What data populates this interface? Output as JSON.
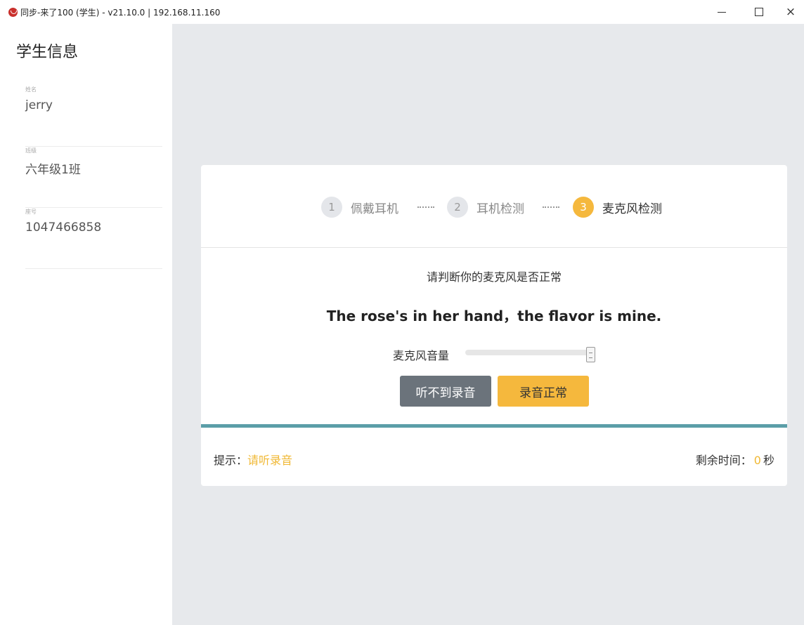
{
  "window": {
    "title": "同步-来了100 (学生) - v21.10.0 | 192.168.11.160",
    "close_glyph": "×"
  },
  "sidebar": {
    "title": "学生信息",
    "items": [
      {
        "label": "姓名",
        "value": "jerry"
      },
      {
        "label": "班级",
        "value": "六年级1班"
      },
      {
        "label": "座号",
        "value": "1047466858"
      }
    ]
  },
  "steps": [
    {
      "number": "1",
      "label": "佩戴耳机",
      "active": false
    },
    {
      "number": "2",
      "label": "耳机检测",
      "active": false
    },
    {
      "number": "3",
      "label": "麦克风检测",
      "active": true
    }
  ],
  "check": {
    "question": "请判断你的麦克风是否正常",
    "sentence": "The rose's in her hand，the flavor is mine.",
    "volume_label": "麦克风音量",
    "volume_level": 1.0
  },
  "buttons": {
    "cannot_hear": "听不到录音",
    "recording_ok": "录音正常"
  },
  "footer": {
    "hint_label": "提示：",
    "hint_value": "请听录音",
    "time_label": "剩余时间：",
    "time_value": "0",
    "time_unit": "秒"
  },
  "colors": {
    "accent": "#f5b83d",
    "progress_bar": "#5b9ea8",
    "background": "#e7e9ec"
  }
}
